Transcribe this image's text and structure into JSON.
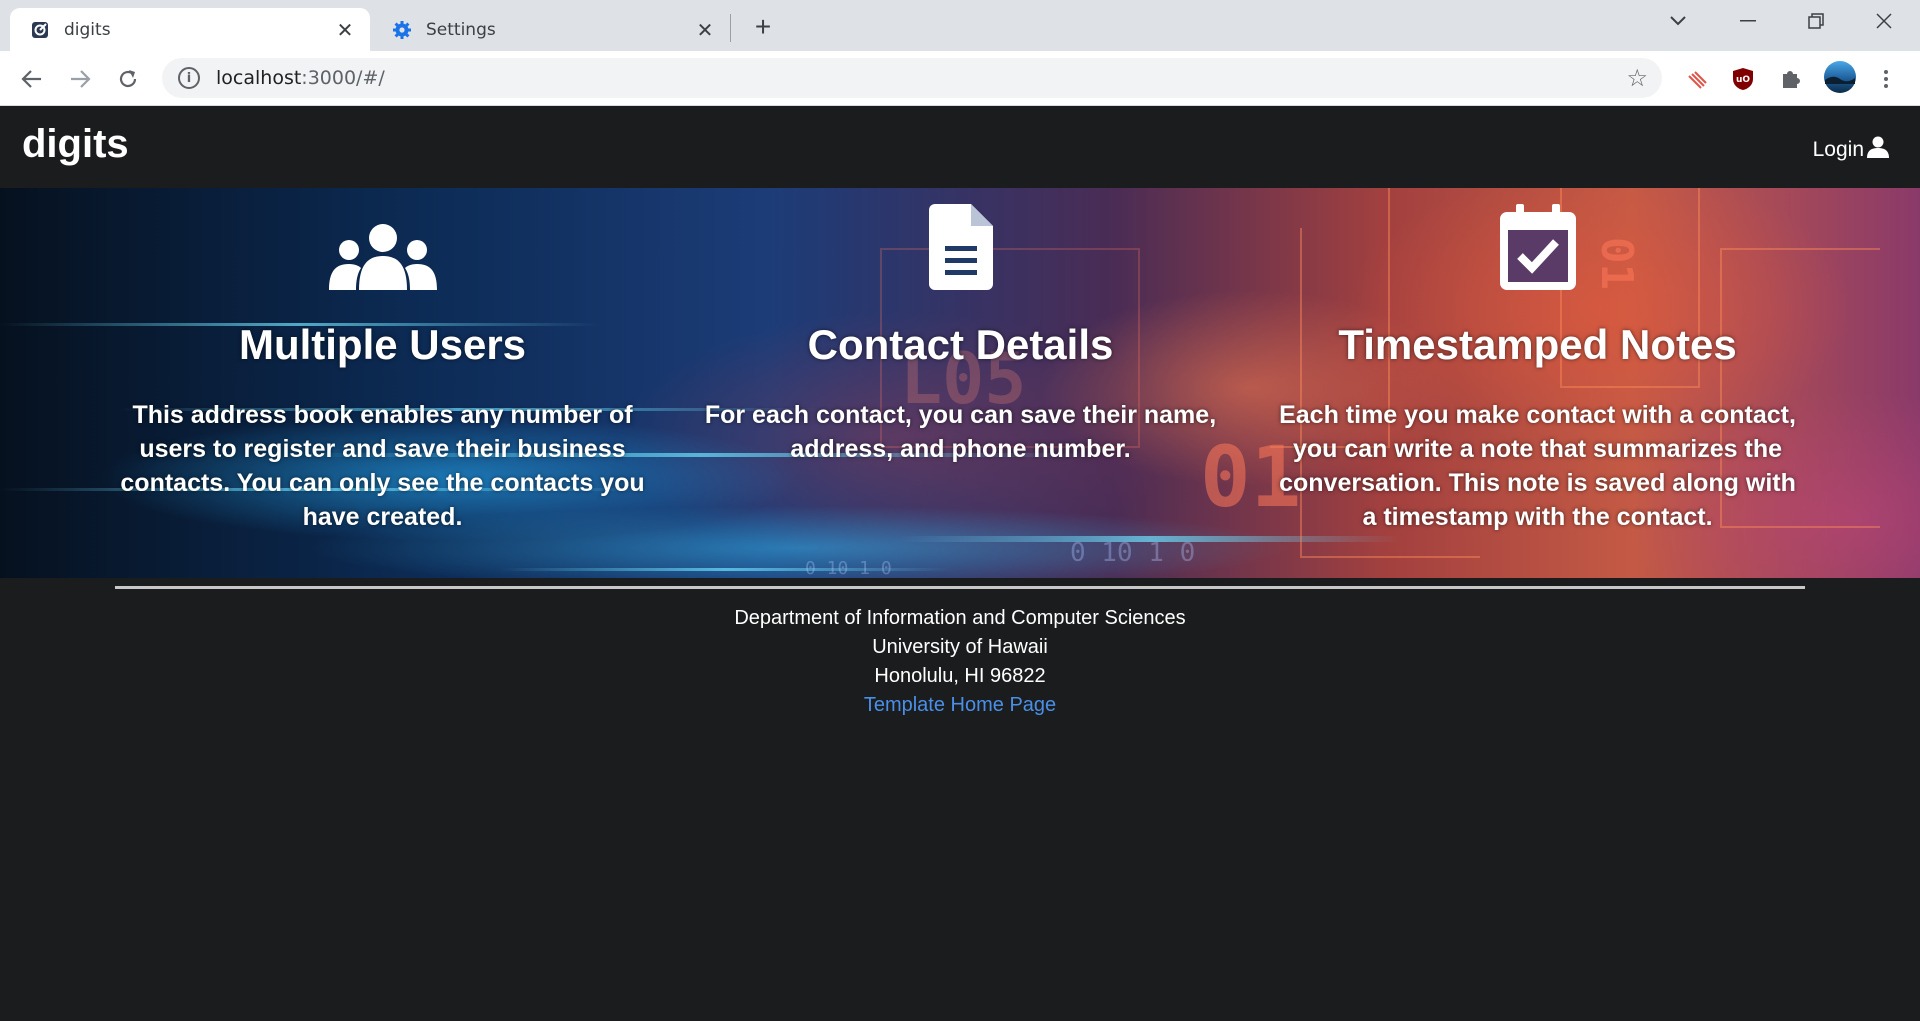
{
  "browser": {
    "tabs": [
      {
        "title": "digits",
        "active": true,
        "favicon": "meteor-favicon-icon"
      },
      {
        "title": "Settings",
        "active": false,
        "favicon": "gear-icon"
      }
    ],
    "url_host": "localhost",
    "url_path": ":3000/#/"
  },
  "navbar": {
    "brand": "digits",
    "login_label": "Login"
  },
  "features": [
    {
      "icon": "users-icon",
      "title": "Multiple Users",
      "text": "This address book enables any number of users to register and save their business contacts. You can only see the contacts you have created."
    },
    {
      "icon": "file-text-icon",
      "title": "Contact Details",
      "text": "For each contact, you can save their name, address, and phone number."
    },
    {
      "icon": "calendar-check-icon",
      "title": "Timestamped Notes",
      "text": "Each time you make contact with a contact, you can write a note that summarizes the conversation. This note is saved along with a timestamp with the contact."
    }
  ],
  "footer": {
    "line1": "Department of Information and Computer Sciences",
    "line2": "University of Hawaii",
    "line3": "Honolulu, HI 96822",
    "link_label": "Template Home Page"
  },
  "colors": {
    "page_background": "#1b1c1d",
    "link": "#4a8fe7",
    "tabstrip": "#dee1e6"
  }
}
